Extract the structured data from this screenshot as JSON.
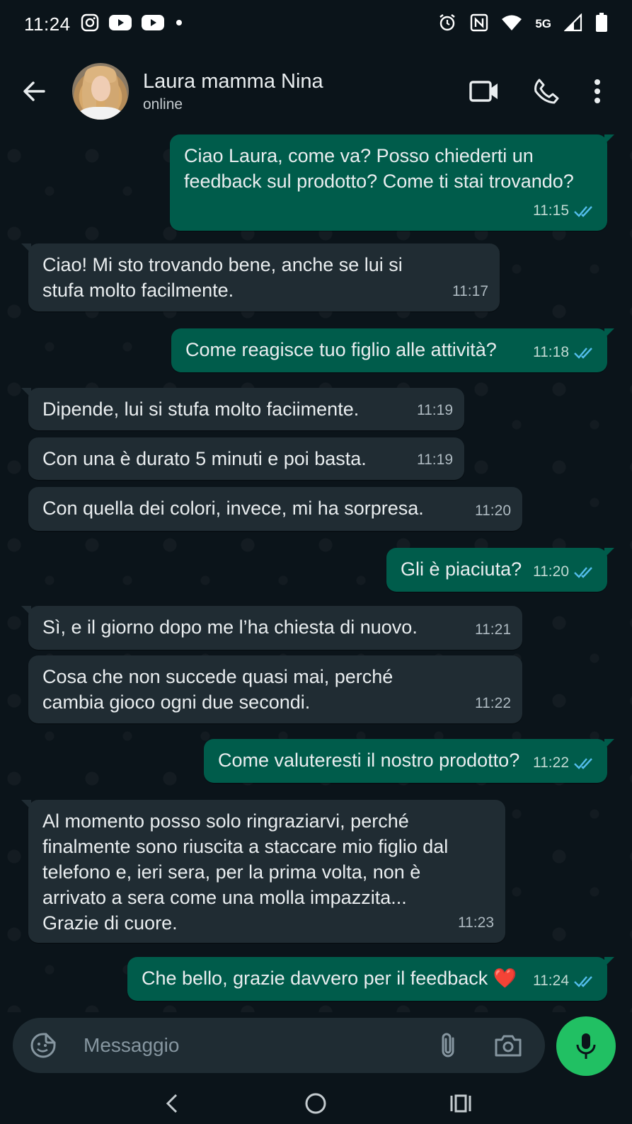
{
  "status_bar": {
    "time": "11:24",
    "network": "5G",
    "notification_icons": [
      "instagram-icon",
      "youtube-icon",
      "youtube-icon",
      "dot-icon"
    ],
    "system_icons": [
      "alarm-icon",
      "nfc-icon",
      "wifi-icon",
      "signal-icon",
      "battery-icon"
    ]
  },
  "header": {
    "contact_name": "Laura mamma Nina",
    "contact_status": "online"
  },
  "messages": [
    {
      "direction": "out",
      "text": "Ciao Laura, come va? Posso chiederti un feedback sul prodotto? Come ti stai trovando?",
      "time": "11:15",
      "read": true
    },
    {
      "direction": "in",
      "text": "Ciao! Mi sto trovando bene, anche se lui si stufa molto facilmente.",
      "time": "11:17"
    },
    {
      "direction": "out",
      "text": "Come reagisce tuo figlio alle attività?",
      "time": "11:18",
      "read": true
    },
    {
      "direction": "in",
      "text": "Dipende, lui si stufa molto faciimente.",
      "time": "11:19"
    },
    {
      "direction": "in",
      "text": "Con una è durato 5 minuti e poi basta.",
      "time": "11:19"
    },
    {
      "direction": "in",
      "text": "Con quella dei colori, invece, mi ha sorpresa.",
      "time": "11:20"
    },
    {
      "direction": "out",
      "text": "Gli è piaciuta?",
      "time": "11:20",
      "read": true
    },
    {
      "direction": "in",
      "text": "Sì, e il giorno dopo me l’ha chiesta di nuovo.",
      "time": "11:21"
    },
    {
      "direction": "in",
      "text": "Cosa che non succede quasi mai, perché cambia gioco ogni due secondi.",
      "time": "11:22"
    },
    {
      "direction": "out",
      "text": "Come valuteresti il nostro prodotto?",
      "time": "11:22",
      "read": true
    },
    {
      "direction": "in",
      "text": "Al momento posso solo ringraziarvi, perché finalmente sono riuscita a staccare mio figlio dal telefono e, ieri sera, per la prima volta, non è arrivato a sera come una molla impazzita... Grazie di cuore.",
      "time": "11:23"
    },
    {
      "direction": "out",
      "text": "Che bello, grazie davvero per il feedback ❤️",
      "time": "11:24",
      "read": true
    }
  ],
  "composer": {
    "placeholder": "Messaggio"
  },
  "colors": {
    "background": "#0b141a",
    "incoming_bubble": "#202c33",
    "outgoing_bubble": "#005c4b",
    "read_ticks": "#53bdeb",
    "mic_button": "#21c063"
  }
}
